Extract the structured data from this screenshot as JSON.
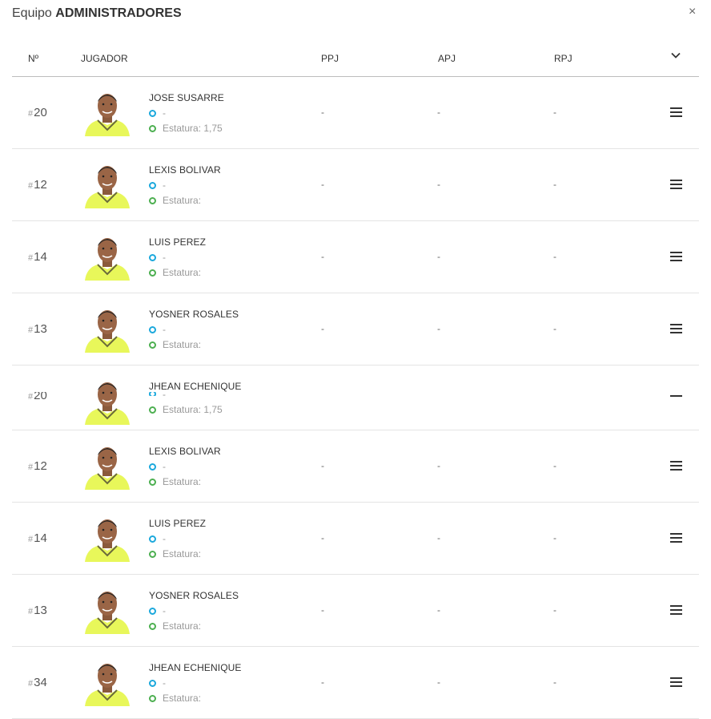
{
  "modal": {
    "title_prefix": "Equipo",
    "title_team": "ADMINISTRADORES",
    "close_label": "×"
  },
  "header": {
    "col_number": "Nº",
    "col_player": "JUGADOR",
    "col_ppj": "PPJ",
    "col_apj": "APJ",
    "col_rpj": "RPJ",
    "expand_icon": "chevron-down-icon"
  },
  "players": [
    {
      "hash": "#",
      "number": "20",
      "name": "JOSE SUSARRE",
      "info": "-",
      "height_label": "Estatura: 1,75",
      "ppj": "-",
      "apj": "-",
      "rpj": "-"
    },
    {
      "hash": "#",
      "number": "12",
      "name": "LEXIS BOLIVAR",
      "info": "-",
      "height_label": "Estatura:",
      "ppj": "-",
      "apj": "-",
      "rpj": "-"
    },
    {
      "hash": "#",
      "number": "14",
      "name": "LUIS PEREZ",
      "info": "-",
      "height_label": "Estatura:",
      "ppj": "-",
      "apj": "-",
      "rpj": "-"
    },
    {
      "hash": "#",
      "number": "13",
      "name": "YOSNER ROSALES",
      "info": "-",
      "height_label": "Estatura:",
      "ppj": "-",
      "apj": "-",
      "rpj": "-"
    },
    {
      "hash": "#",
      "number": "20",
      "name": "JHEAN ECHENIQUE",
      "info": "-",
      "height_label": "Estatura: 1,75",
      "ppj": "-",
      "apj": "-",
      "rpj": "-"
    },
    {
      "hash": "#",
      "number": "12",
      "name": "LEXIS BOLIVAR",
      "info": "-",
      "height_label": "Estatura:",
      "ppj": "-",
      "apj": "-",
      "rpj": "-"
    },
    {
      "hash": "#",
      "number": "14",
      "name": "LUIS PEREZ",
      "info": "-",
      "height_label": "Estatura:",
      "ppj": "-",
      "apj": "-",
      "rpj": "-"
    },
    {
      "hash": "#",
      "number": "13",
      "name": "YOSNER ROSALES",
      "info": "-",
      "height_label": "Estatura:",
      "ppj": "-",
      "apj": "-",
      "rpj": "-"
    },
    {
      "hash": "#",
      "number": "34",
      "name": "JHEAN ECHENIQUE",
      "info": "-",
      "height_label": "Estatura:",
      "ppj": "-",
      "apj": "-",
      "rpj": "-"
    }
  ],
  "colors": {
    "jersey": "#e8f75a",
    "info_dot": "#1ba8dc",
    "height_dot": "#4caf50"
  }
}
